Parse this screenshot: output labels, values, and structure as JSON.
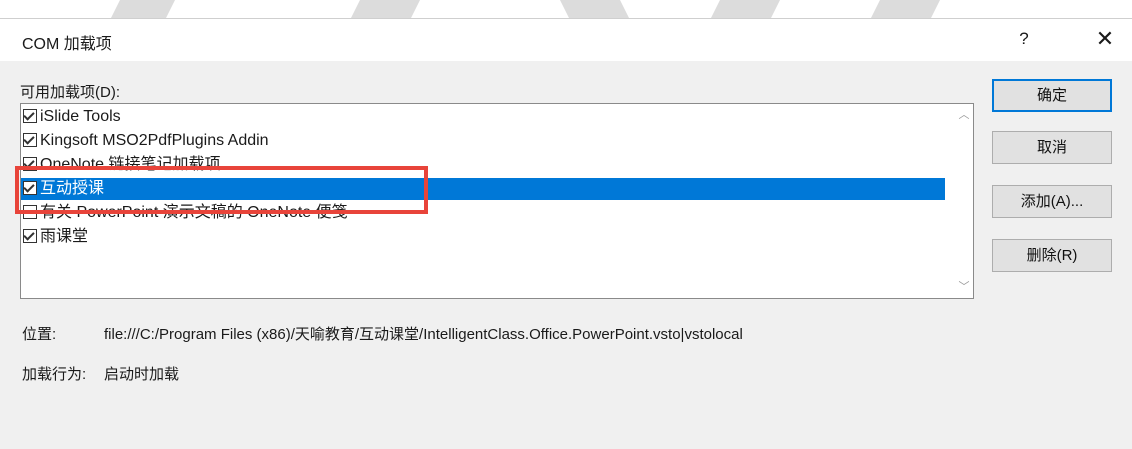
{
  "dialog": {
    "title": "COM 加载项",
    "help": "?",
    "close": "✕"
  },
  "list": {
    "label": "可用加载项(D):",
    "items": [
      {
        "label": "iSlide Tools",
        "checked": true,
        "selected": false
      },
      {
        "label": "Kingsoft MSO2PdfPlugins Addin",
        "checked": true,
        "selected": false
      },
      {
        "label": "OneNote 链接笔记加载项",
        "checked": true,
        "selected": false
      },
      {
        "label": "互动授课",
        "checked": true,
        "selected": true
      },
      {
        "label": "有关 PowerPoint 演示文稿的 OneNote 便笺",
        "checked": false,
        "selected": false
      },
      {
        "label": "雨课堂",
        "checked": true,
        "selected": false
      }
    ]
  },
  "buttons": {
    "ok": "确定",
    "cancel": "取消",
    "add": "添加(A)...",
    "remove": "删除(R)"
  },
  "details": {
    "location_label": "位置:",
    "location_value": "file:///C:/Program Files (x86)/天喻教育/互动课堂/IntelligentClass.Office.PowerPoint.vsto|vstolocal",
    "behavior_label": "加载行为:",
    "behavior_value": "启动时加载"
  },
  "colors": {
    "selection": "#0078d7",
    "highlight_box": "#e8443a",
    "dialog_bg": "#f0f0f0"
  }
}
